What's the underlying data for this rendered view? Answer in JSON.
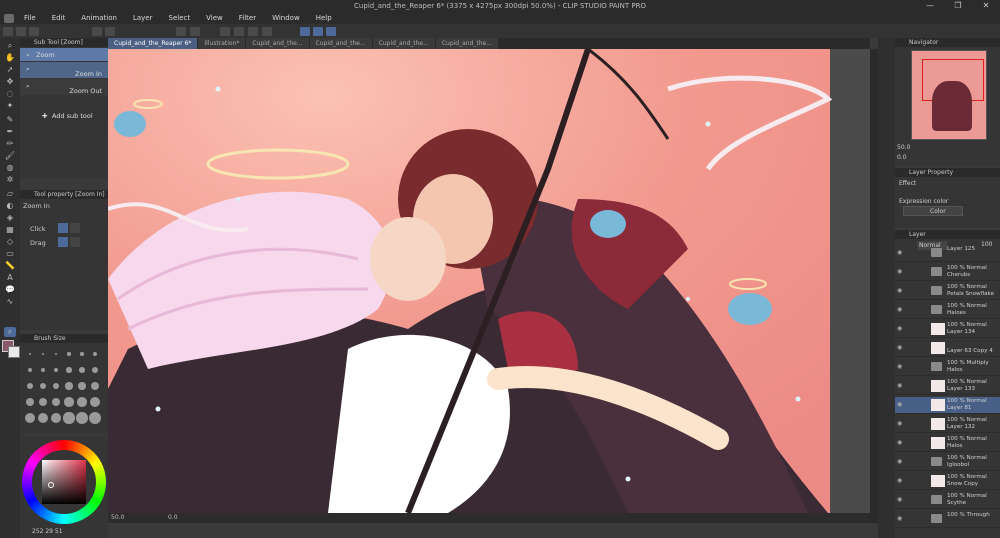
{
  "window": {
    "title": "Cupid_and_the_Reaper 6* (3375 x 4275px 300dpi 50.0%) - CLIP STUDIO PAINT PRO",
    "controls": [
      "—",
      "❐",
      "✕"
    ]
  },
  "menu": [
    "File",
    "Edit",
    "Animation",
    "Layer",
    "Select",
    "View",
    "Filter",
    "Window",
    "Help"
  ],
  "sub_tool": {
    "header": "Sub Tool [Zoom]",
    "group": "Zoom",
    "items": [
      "Zoom In",
      "Zoom Out"
    ],
    "add_label": "Add sub tool"
  },
  "tool_property": {
    "header": "Tool property [Zoom In]",
    "title": "Zoom In",
    "click_label": "Click",
    "drag_label": "Drag"
  },
  "brush_size": {
    "header": "Brush Size"
  },
  "tabs": [
    {
      "label": "Cupid_and_the_Reaper 6*",
      "active": true
    },
    {
      "label": "Illustration*",
      "active": false
    },
    {
      "label": "Cupid_and_the...",
      "active": false
    },
    {
      "label": "Cupid_and_the...",
      "active": false
    },
    {
      "label": "Cupid_and_the...",
      "active": false
    },
    {
      "label": "Cupid_and_the...",
      "active": false
    }
  ],
  "canvas": {
    "zoom": "50.0",
    "angle": "0.0"
  },
  "color_panel": {
    "readout": "252 29 51"
  },
  "navigator": {
    "header": "Navigator",
    "zoom": "50.0",
    "angle": "0.0"
  },
  "layer_property": {
    "header": "Layer Property",
    "effect_label": "Effect",
    "expression_label": "Expression color",
    "expression_value": "Color"
  },
  "layer_panel": {
    "header": "Layer",
    "blend_mode": "Normal",
    "opacity": "100",
    "layers": [
      {
        "l1": "Layer 125",
        "l2": "",
        "type": "folder"
      },
      {
        "l1": "100 % Normal",
        "l2": "Cherubs",
        "type": "folder"
      },
      {
        "l1": "100 % Normal",
        "l2": "Petals Snowflake",
        "type": "folder"
      },
      {
        "l1": "100 % Normal",
        "l2": "Haloes",
        "type": "folder"
      },
      {
        "l1": "100 % Normal",
        "l2": "Layer 134",
        "type": "layer"
      },
      {
        "l1": "",
        "l2": "Layer 63 Copy 4",
        "type": "layer"
      },
      {
        "l1": "100 % Multiply",
        "l2": "Halos",
        "type": "folder"
      },
      {
        "l1": "100 % Normal",
        "l2": "Layer 133",
        "type": "layer"
      },
      {
        "l1": "100 % Normal",
        "l2": "Layer 81",
        "type": "layer",
        "selected": true
      },
      {
        "l1": "100 % Normal",
        "l2": "Layer 132",
        "type": "layer"
      },
      {
        "l1": "100 % Normal",
        "l2": "Halos",
        "type": "layer"
      },
      {
        "l1": "100 % Normal",
        "l2": "Igloobol",
        "type": "folder"
      },
      {
        "l1": "100 % Normal",
        "l2": "Snow Copy",
        "type": "layer"
      },
      {
        "l1": "100 % Normal",
        "l2": "Scythe",
        "type": "folder"
      },
      {
        "l1": "100 % Through",
        "l2": "",
        "type": "folder"
      }
    ]
  },
  "colors": {
    "accent": "#4d6a9a",
    "canvas_bg": "#f29a8f",
    "panel": "#353535"
  }
}
